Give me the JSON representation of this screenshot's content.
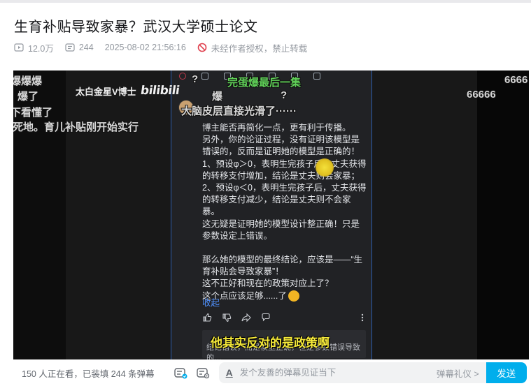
{
  "video": {
    "title": "生育补贴导致家暴？武汉大学硕士论文",
    "views": "12.0万",
    "danmaku_count": "244",
    "published": "2025-08-02 21:56:16",
    "copyright_notice": "未经作者授权，禁止转载"
  },
  "player": {
    "watermark_author": "太白金星V博士",
    "watermark_logo": "bilibili",
    "danmaku": [
      {
        "text": "爆爆爆",
        "color": "gray"
      },
      {
        "text": "爆了",
        "color": "gray"
      },
      {
        "text": "下看懂了",
        "color": "gray"
      },
      {
        "text": "死地。育儿补贴刚开始实行",
        "color": "gray"
      },
      {
        "text": "完蛋爆最后一集",
        "color": "green"
      },
      {
        "text": "爆",
        "color": "gray"
      },
      {
        "text": "?",
        "color": "gray"
      },
      {
        "text": "?",
        "color": "gray"
      },
      {
        "text": "大脑皮层直接光滑了······",
        "color": "gray"
      },
      {
        "text": "66666",
        "color": "gray"
      },
      {
        "text": "6666",
        "color": "gray"
      }
    ],
    "comment": {
      "lines": [
        "博主能否再简化一点，更有利于传播。",
        "另外，你的论证过程，没有证明该模型是错误的，反而是证明她的模型是正确的！",
        "1、预设φ＞0，表明生完孩子后，丈夫获得的转移支付增加，结论是丈夫则会家暴；",
        "2、预设φ＜0，表明生完孩子后，丈夫获得的转移支付减少，结论是丈夫则不会家暴。",
        "这无疑是证明她的模型设计整正确！只是参数设定上错误。"
      ],
      "conclusion_lines": [
        "那么她的模型的最终结论，应该是——“生育补贴会导致家暴”！",
        "这不正好和现在的政策对应上了？",
        "这个点应该足够......了"
      ],
      "collapse_label": "收起",
      "reply_preview": "结论错误，而是模型正确，但是参数错误导致的…"
    },
    "subtitle": "他其实反对的是政策啊"
  },
  "bottom_bar": {
    "viewer_info": "150 人正在看，已装填 244 条弹幕",
    "input_placeholder": "发个友善的弹幕见证当下",
    "etiquette_label": "弹幕礼仪 >",
    "send_label": "发送"
  },
  "colors": {
    "accent": "#00aeec",
    "title_text": "#18191c",
    "meta_text": "#9499a0",
    "subtitle_yellow": "#f5e93a",
    "danmaku_green": "#5fcf57",
    "link_blue": "#4f8ef7"
  }
}
